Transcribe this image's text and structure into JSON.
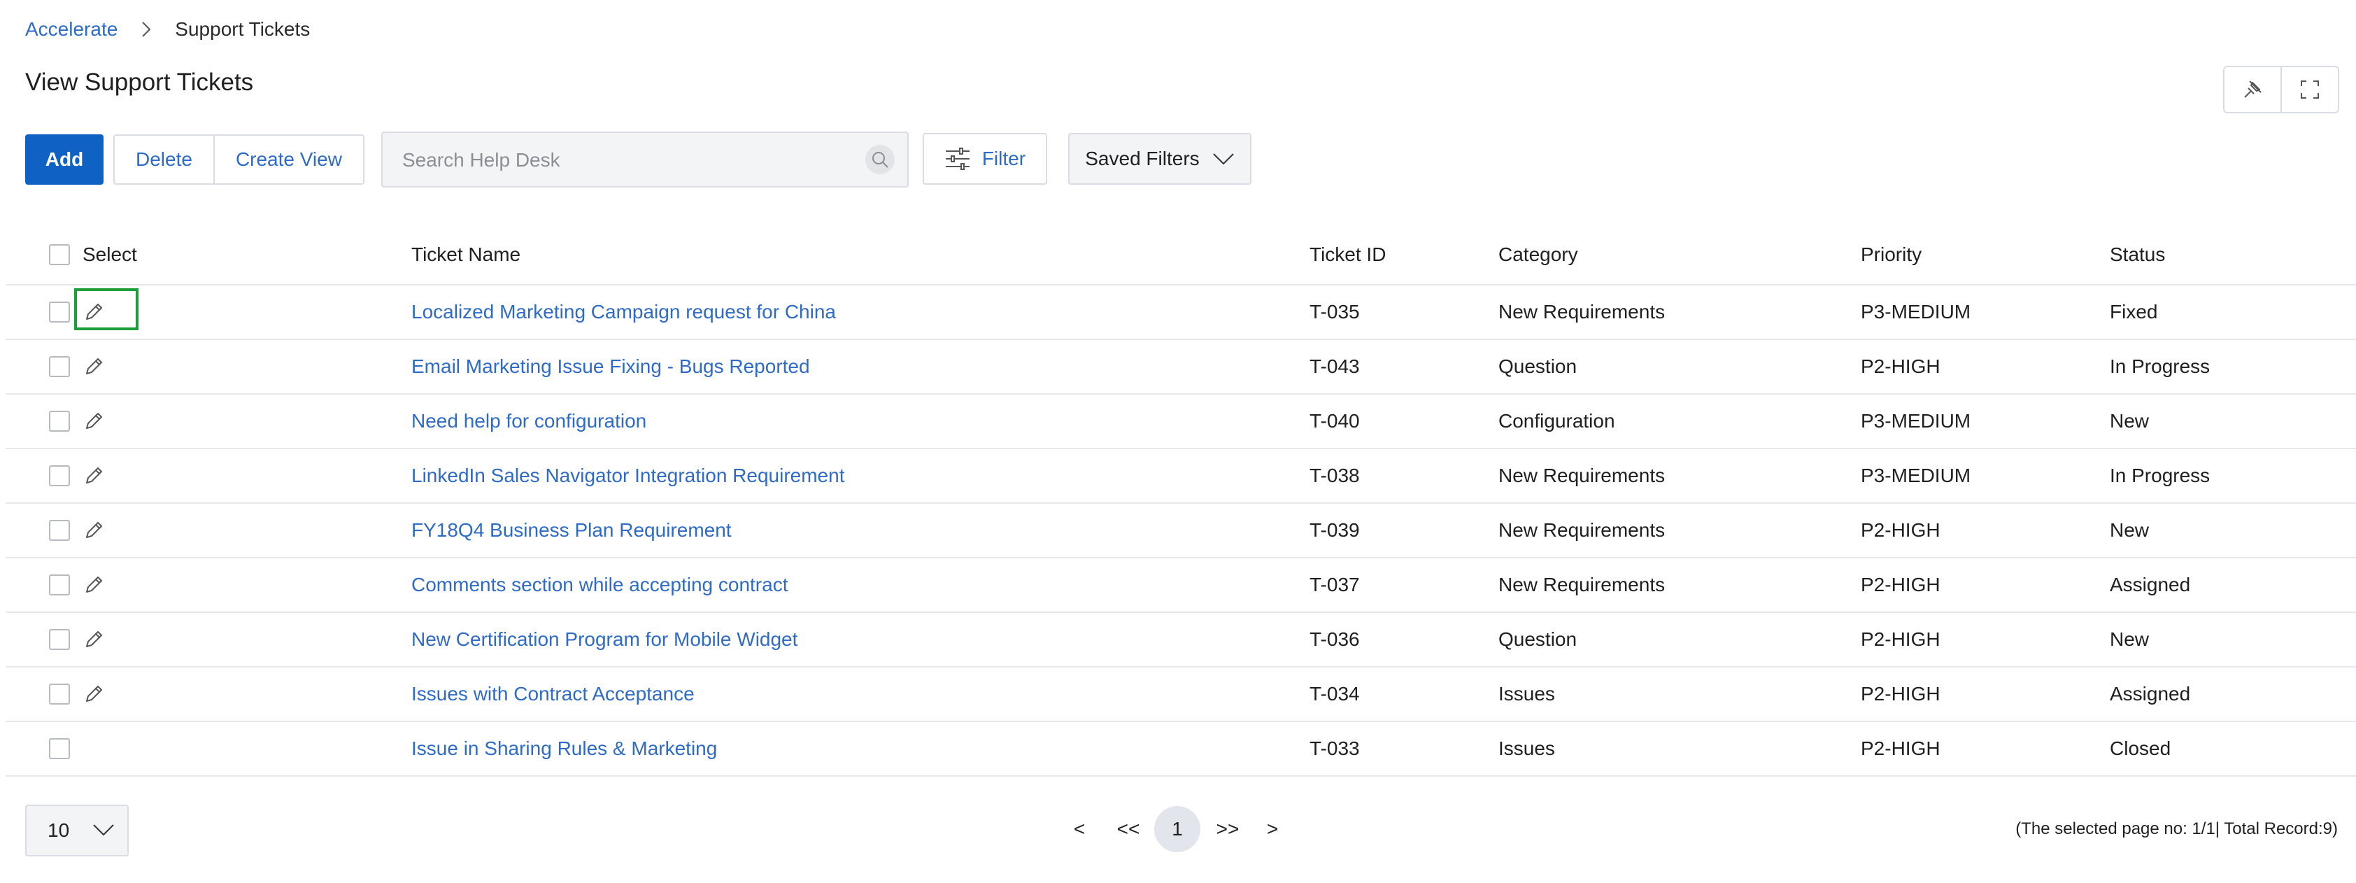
{
  "breadcrumb": {
    "root": "Accelerate",
    "current": "Support Tickets"
  },
  "page": {
    "title": "View Support Tickets"
  },
  "toolbar": {
    "add_label": "Add",
    "delete_label": "Delete",
    "create_view_label": "Create View",
    "search_placeholder": "Search Help Desk",
    "filter_label": "Filter",
    "saved_filters_label": "Saved Filters"
  },
  "table": {
    "headers": {
      "select": "Select",
      "name": "Ticket Name",
      "id": "Ticket ID",
      "category": "Category",
      "priority": "Priority",
      "status": "Status"
    },
    "rows": [
      {
        "name": "Localized Marketing Campaign request for China",
        "id": "T-035",
        "category": "New Requirements",
        "priority": "P3-MEDIUM",
        "status": "Fixed"
      },
      {
        "name": "Email Marketing Issue Fixing - Bugs Reported",
        "id": "T-043",
        "category": "Question",
        "priority": "P2-HIGH",
        "status": "In Progress"
      },
      {
        "name": "Need help for configuration",
        "id": "T-040",
        "category": "Configuration",
        "priority": "P3-MEDIUM",
        "status": "New"
      },
      {
        "name": "LinkedIn Sales Navigator Integration Requirement",
        "id": "T-038",
        "category": "New Requirements",
        "priority": "P3-MEDIUM",
        "status": "In Progress"
      },
      {
        "name": "FY18Q4 Business Plan Requirement",
        "id": "T-039",
        "category": "New Requirements",
        "priority": "P2-HIGH",
        "status": "New"
      },
      {
        "name": "Comments section while accepting contract",
        "id": "T-037",
        "category": "New Requirements",
        "priority": "P2-HIGH",
        "status": "Assigned"
      },
      {
        "name": "New Certification Program for Mobile Widget",
        "id": "T-036",
        "category": "Question",
        "priority": "P2-HIGH",
        "status": "New"
      },
      {
        "name": "Issues with Contract Acceptance",
        "id": "T-034",
        "category": "Issues",
        "priority": "P2-HIGH",
        "status": "Assigned"
      },
      {
        "name": "Issue in Sharing Rules & Marketing",
        "id": "T-033",
        "category": "Issues",
        "priority": "P2-HIGH",
        "status": "Closed"
      }
    ]
  },
  "footer": {
    "page_size": "10",
    "pager": {
      "prev": "<",
      "first": "<<",
      "current": "1",
      "last": ">>",
      "next": ">"
    },
    "record_info": "(The selected page no: 1/1| Total Record:9)"
  }
}
